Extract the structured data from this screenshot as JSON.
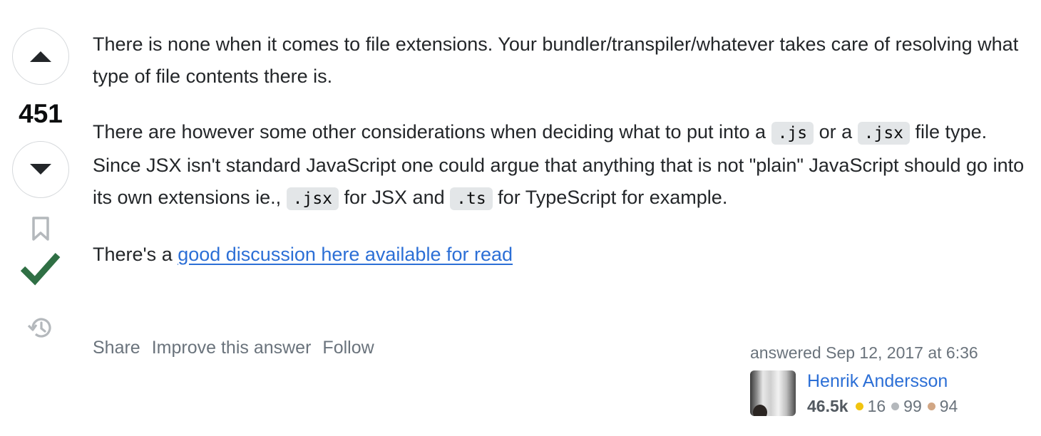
{
  "votes": {
    "score": "451"
  },
  "answer": {
    "p1": "There is none when it comes to file extensions. Your bundler/transpiler/whatever takes care of resolving what type of file contents there is.",
    "p2_part1": "There are however some other considerations when deciding what to put into a ",
    "p2_code1": ".js",
    "p2_part2": " or a ",
    "p2_code2": ".jsx",
    "p2_part3": " file type. Since JSX isn't standard JavaScript one could argue that anything that is not \"plain\" JavaScript should go into its own extensions ie., ",
    "p2_code3": ".jsx",
    "p2_part4": " for JSX and ",
    "p2_code4": ".ts",
    "p2_part5": " for TypeScript for example.",
    "p3_prefix": "There's a ",
    "p3_link": "good discussion here available for read"
  },
  "actions": {
    "share": "Share",
    "improve": "Improve this answer",
    "follow": "Follow"
  },
  "user_card": {
    "answered": "answered Sep 12, 2017 at 6:36",
    "name": "Henrik Andersson",
    "reputation": "46.5k",
    "gold": "16",
    "silver": "99",
    "bronze": "94"
  },
  "colors": {
    "accepted_green": "#2f6f44",
    "link_blue": "#2c6fd6",
    "gold": "#f1c40f",
    "silver": "#b4b8bc",
    "bronze": "#d1a684"
  },
  "icons": {
    "upvote": "triangle-up-icon",
    "downvote": "triangle-down-icon",
    "bookmark": "bookmark-icon",
    "accepted": "checkmark-icon",
    "history": "history-icon"
  }
}
